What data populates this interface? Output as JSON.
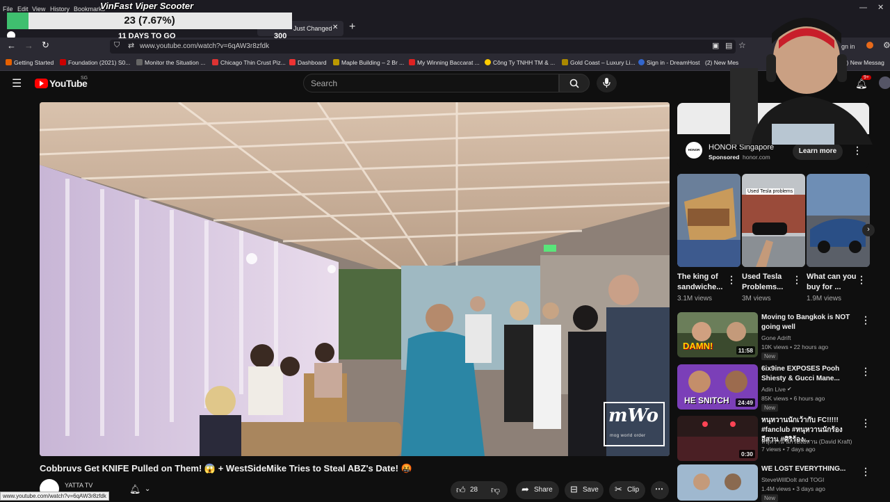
{
  "browser": {
    "menu": [
      "File",
      "Edit",
      "View",
      "History",
      "Bookmarks"
    ],
    "tab_partial": "Just Changed",
    "url": "www.youtube.com/watch?v=6qAW3r8zfdk",
    "signin_partial": "gn in",
    "bookmarks": [
      "Getting Started",
      "Foundation (2021) S0...",
      "Monitor the Situation ...",
      "Chicago Thin Crust Piz...",
      "Dashboard",
      "Maple Building – 2 Br ...",
      "My Winning Baccarat ...",
      "Công Ty TNHH TM & ...",
      "Gold Coast – Luxury Li...",
      "Sign in - DreamHost",
      "(2) New Mes",
      "(1) New Messag"
    ],
    "status_url": "www.youtube.com/watch?v=6qAW3r8zfdk"
  },
  "overlay": {
    "goal_title": "VinFast Viper Scooter",
    "progress_text": "23 (7.67%)",
    "progress_fraction": 0.0767,
    "days_text": "11 DAYS TO GO",
    "goal_value": "300"
  },
  "youtube": {
    "logo_text": "YouTube",
    "logo_country": "SG",
    "search_placeholder": "Search",
    "notif_count": "9+",
    "colors": {
      "brand": "#ff0000",
      "bg": "#0f0f0f"
    }
  },
  "video": {
    "title": "Cobbruvs Get KNIFE Pulled on Them! 😱 + WestSideMike Tries to Steal ABZ's Date! 🤬",
    "watermark": "mWo",
    "watermark_sub": "mog world order",
    "channel": "YATTA TV",
    "likes": "28",
    "share_label": "Share",
    "save_label": "Save",
    "clip_label": "Clip"
  },
  "ad": {
    "brand_logo": "HONOR",
    "name": "HONOR Singapore",
    "sponsored": "Sponsored",
    "domain": "honor.com",
    "cta": "Learn more"
  },
  "shorts": [
    {
      "title": "The king of sandwiche...",
      "views": "3.1M views",
      "overlay": ""
    },
    {
      "title": "Used Tesla Problems...",
      "views": "3M views",
      "overlay": "Used Tesla problems"
    },
    {
      "title": "What can you buy for ...",
      "views": "1.9M views",
      "overlay": ""
    }
  ],
  "recommendations": [
    {
      "title": "Moving to Bangkok is NOT going well",
      "channel": "Gone Adrift",
      "meta": "10K views • 22 hours ago",
      "badge": "New",
      "duration": "11:58",
      "thumb_text": "DAMN!"
    },
    {
      "title": "6ix9ine EXPOSES Pooh Shiesty & Gucci Mane...",
      "channel": "Adin Live",
      "meta": "85K views • 6 hours ago",
      "badge": "New",
      "duration": "24:49",
      "thumb_text": "HE SNITCH"
    },
    {
      "title": "หนุหวานนักเว้ากับ FC!!!!! #fanclub #หนุหวานนักร้องอีสาน #ศิริร้อง...",
      "channel": "หนุหวาน นักร้องอีสาน (David Kraft)",
      "meta": "7 views • 7 days ago",
      "badge": "",
      "duration": "0:30",
      "thumb_text": ""
    },
    {
      "title": "WE LOST EVERYTHING...",
      "channel": "SteveWillDoIt and TOGI",
      "meta": "1.4M views • 3 days ago",
      "badge": "New",
      "duration": "",
      "thumb_text": ""
    }
  ]
}
